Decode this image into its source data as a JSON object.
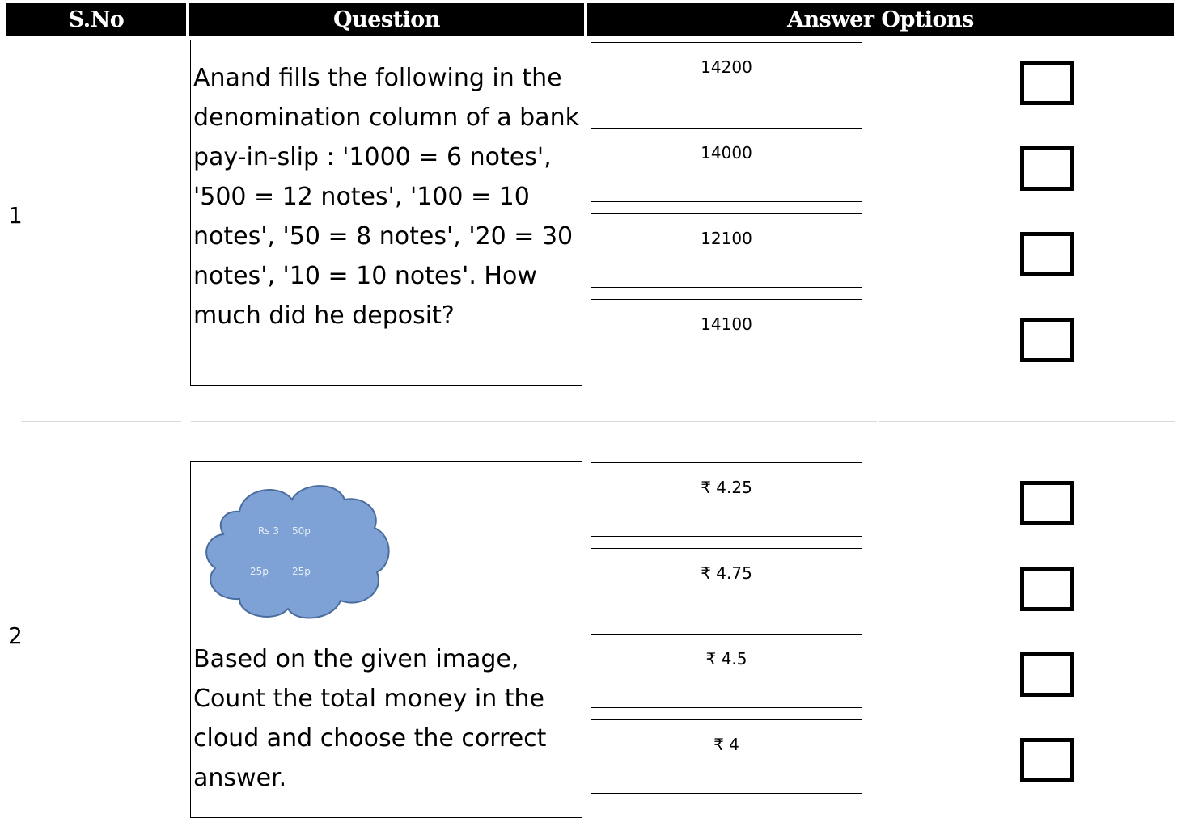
{
  "header": {
    "sno": "S.No",
    "question": "Question",
    "answer_options": "Answer Options"
  },
  "questions": [
    {
      "sno": "1",
      "text": "Anand fills the following in the denomination column of a bank pay-in-slip : '1000 = 6 notes', '500 = 12 notes', '100 = 10 notes', '50 = 8 notes', '20 = 30 notes', '10 = 10 notes'. How much did he deposit?",
      "options": [
        "14200",
        "14000",
        "12100",
        "14100"
      ]
    },
    {
      "sno": "2",
      "image_labels": [
        "Rs 3",
        "50p",
        "25p",
        "25p"
      ],
      "text": "Based on the given image, Count the total money in the cloud and choose the correct answer.",
      "options": [
        "₹ 4.25",
        "₹ 4.75",
        "₹ 4.5",
        "₹ 4"
      ]
    }
  ]
}
